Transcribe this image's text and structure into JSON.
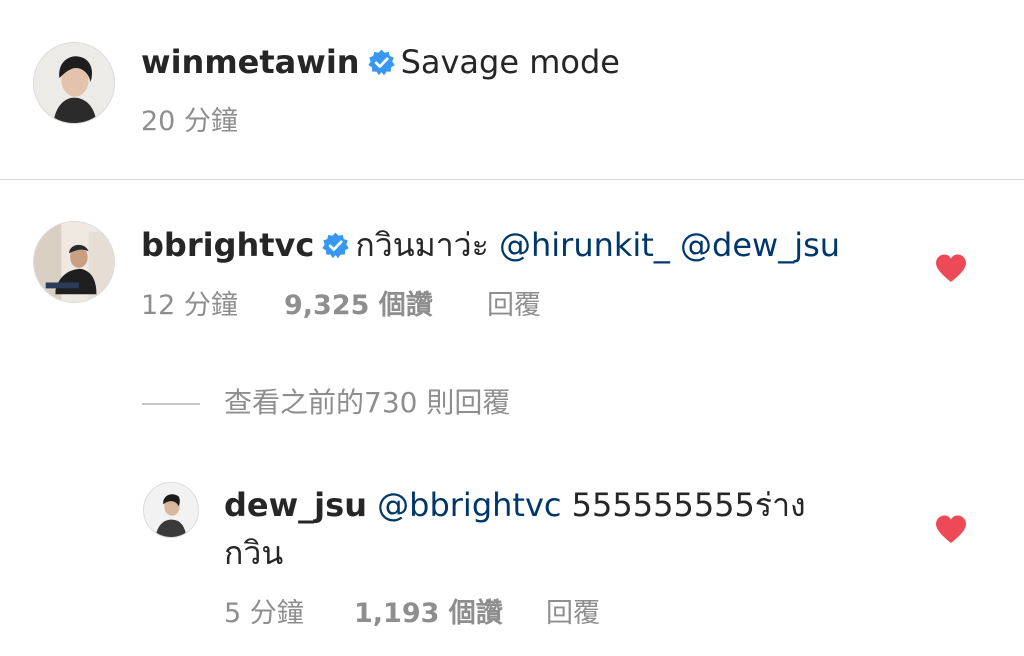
{
  "post": {
    "username": "winmetawin",
    "verified": true,
    "caption": "Savage mode",
    "time": "20 分鐘"
  },
  "comments": [
    {
      "username": "bbrightvc",
      "verified": true,
      "text": "กวินมาว่ะ",
      "mentions": [
        "@hirunkit_",
        "@dew_jsu"
      ],
      "time": "12 分鐘",
      "likes": "9,325 個讚",
      "reply_label": "回覆",
      "liked": true
    }
  ],
  "view_previous": "查看之前的730 則回覆",
  "replies": [
    {
      "username": "dew_jsu",
      "mention": "@bbrightvc",
      "text_line1": "555555555ร่าง",
      "text_line2": "กวิน",
      "time": "5 分鐘",
      "likes": "1,193 個讚",
      "reply_label": "回覆",
      "liked": true
    }
  ],
  "colors": {
    "verified": "#3897f0",
    "heart": "#ed4956",
    "mention": "#00376b",
    "meta": "#8e8e8e"
  },
  "icons": {
    "verified": "verified-badge-icon",
    "heart": "heart-filled-icon"
  }
}
